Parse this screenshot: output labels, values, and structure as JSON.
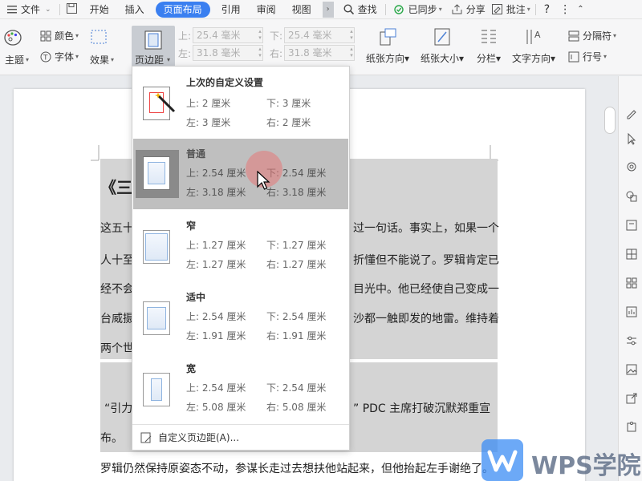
{
  "tabbar": {
    "file_label": "文件",
    "tabs": [
      "开始",
      "插入",
      "页面布局",
      "引用",
      "审阅",
      "视图"
    ],
    "search_label": "查找",
    "sync_label": "已同步",
    "share_label": "分享",
    "comment_label": "批注",
    "help_label": "?"
  },
  "ribbon": {
    "theme_label": "主题",
    "color_label": "颜色",
    "font_label": "字体",
    "effect_label": "效果",
    "margin_label": "页边距",
    "top_label": "上:",
    "top_value": "25.4 毫米",
    "bottom_label": "下:",
    "bottom_value": "25.4 毫米",
    "left_label": "左:",
    "left_value": "31.8 毫米",
    "right_label": "右:",
    "right_value": "31.8 毫米",
    "orientation_label": "纸张方向",
    "size_label": "纸张大小",
    "columns_label": "分栏",
    "text_direction_label": "文字方向",
    "separator_label": "分隔符",
    "line_number_label": "行号"
  },
  "dropdown": {
    "options": [
      {
        "title": "上次的自定义设置",
        "top": "上: 2 厘米",
        "bottom": "下: 3 厘米",
        "left": "左: 3 厘米",
        "right": "右: 2 厘米"
      },
      {
        "title": "普通",
        "top": "上: 2.54 厘米",
        "bottom": "下: 2.54 厘米",
        "left": "左: 3.18 厘米",
        "right": "右: 3.18 厘米"
      },
      {
        "title": "窄",
        "top": "上: 1.27 厘米",
        "bottom": "下: 1.27 厘米",
        "left": "左: 1.27 厘米",
        "right": "右: 1.27 厘米"
      },
      {
        "title": "适中",
        "top": "上: 2.54 厘米",
        "bottom": "下: 2.54 厘米",
        "left": "左: 1.91 厘米",
        "right": "右: 1.91 厘米"
      },
      {
        "title": "宽",
        "top": "上: 2.54 厘米",
        "bottom": "下: 2.54 厘米",
        "left": "左: 5.08 厘米",
        "right": "右: 5.08 厘米"
      }
    ],
    "custom_label": "自定义页边距(A)..."
  },
  "document": {
    "title_visible": "《三",
    "lines": [
      {
        "left": "这五十",
        "right": "过一句话。事实上，如果一个"
      },
      {
        "left": "人十至",
        "right": "折懂但不能说了。罗辑肯定已"
      },
      {
        "left": "经不会",
        "right": "目光中。他已经使自己变成一"
      },
      {
        "left": "台威摄",
        "right": "沙都一触即发的地雷。维持着"
      },
      {
        "left": "两个世",
        "right": ""
      }
    ],
    "quote_left": "“引力",
    "quote_right": "” PDC 主席打破沉默郑重宣",
    "quote_end": "布。",
    "last_line": "罗辑仍然保持原姿态不动，参谋长走过去想扶他站起来，但他抬起左手谢绝了。"
  },
  "watermark": {
    "text": "WPS学院"
  },
  "colors": {
    "accent": "#3a7ff0",
    "hover": "#bfbfbf",
    "highlight": "#d4d4d4"
  }
}
